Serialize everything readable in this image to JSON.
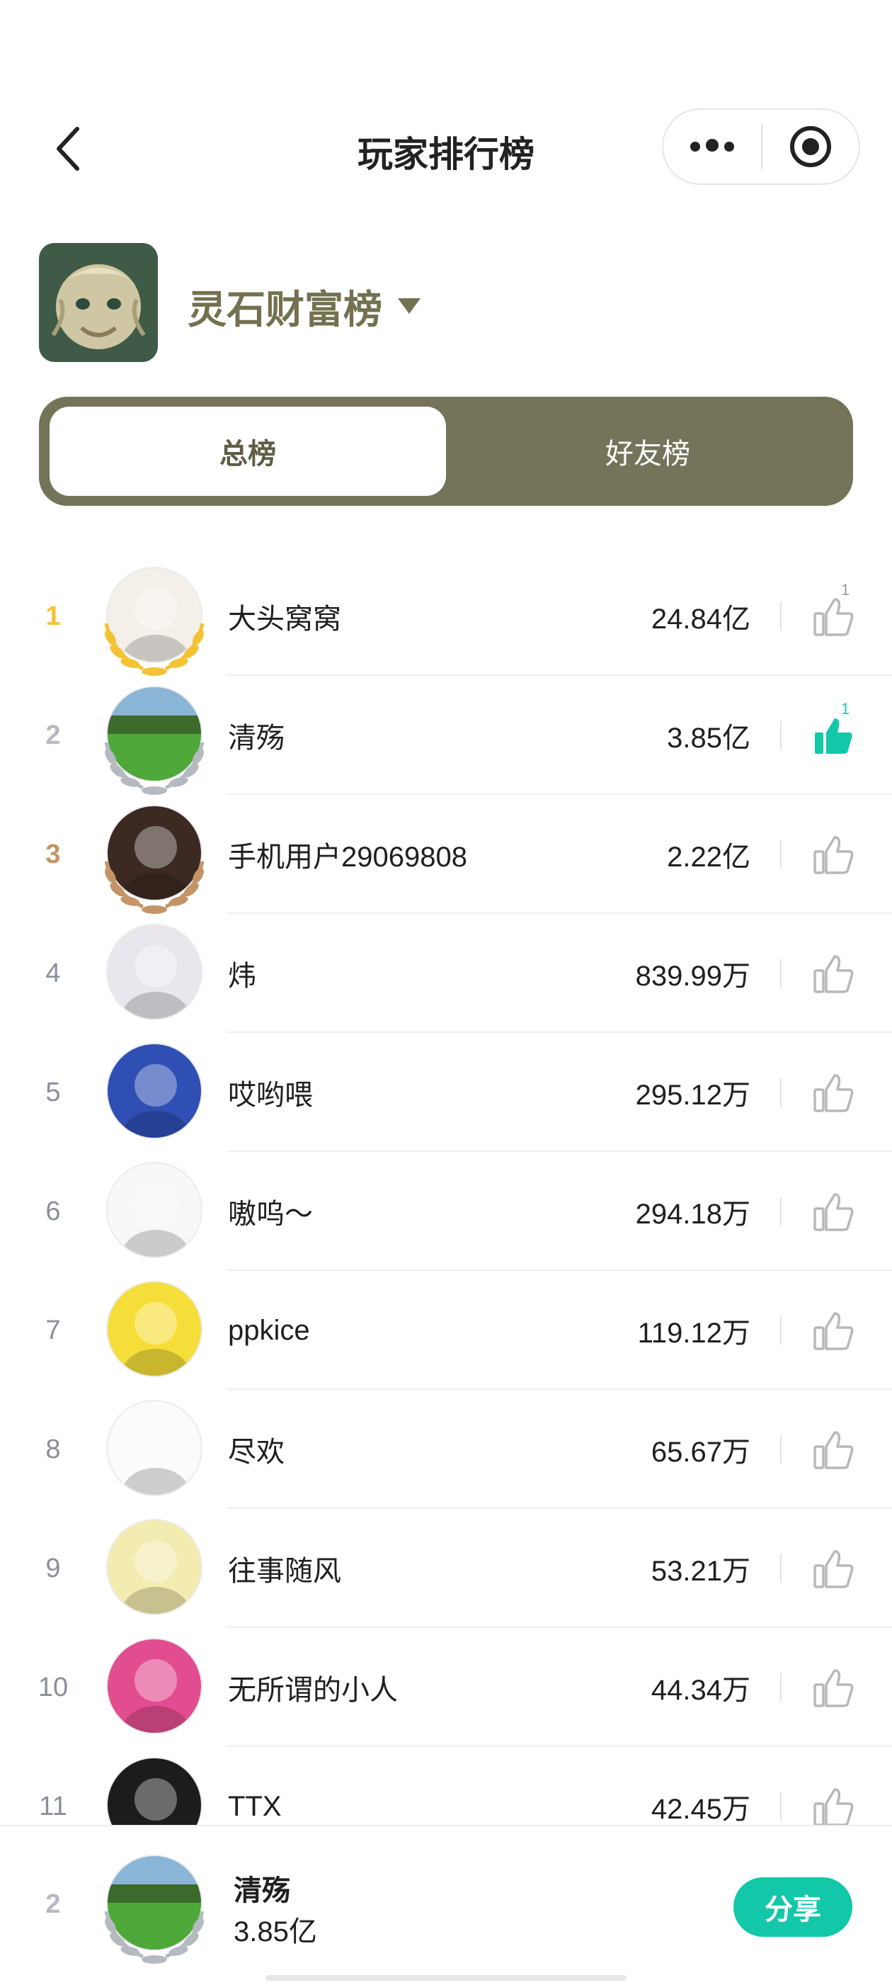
{
  "header": {
    "title": "玩家排行榜"
  },
  "board": {
    "name": "灵石财富榜"
  },
  "tabs": [
    {
      "label": "总榜",
      "active": true
    },
    {
      "label": "好友榜",
      "active": false
    }
  ],
  "ranking": [
    {
      "rank": "1",
      "name": "大头窝窝",
      "score": "24.84亿",
      "likes": "1",
      "liked": false,
      "avatar_color": "#f5efe9"
    },
    {
      "rank": "2",
      "name": "清殇",
      "score": "3.85亿",
      "likes": "1",
      "liked": true,
      "avatar_color": "#4f9a34"
    },
    {
      "rank": "3",
      "name": "手机用户29069808",
      "score": "2.22亿",
      "likes": "",
      "liked": false,
      "avatar_color": "#3c2a22"
    },
    {
      "rank": "4",
      "name": "炜",
      "score": "839.99万",
      "likes": "",
      "liked": false,
      "avatar_color": "#e9e6ee"
    },
    {
      "rank": "5",
      "name": "哎哟喂",
      "score": "295.12万",
      "likes": "",
      "liked": false,
      "avatar_color": "#2f4fb4"
    },
    {
      "rank": "6",
      "name": "嗷呜～",
      "score": "294.18万",
      "likes": "",
      "liked": false,
      "avatar_color": "#f8f8f8"
    },
    {
      "rank": "7",
      "name": "ppkice",
      "score": "119.12万",
      "likes": "",
      "liked": false,
      "avatar_color": "#f6de3a"
    },
    {
      "rank": "8",
      "name": "尽欢",
      "score": "65.67万",
      "likes": "",
      "liked": false,
      "avatar_color": "#fbfbfb"
    },
    {
      "rank": "9",
      "name": "往事随风",
      "score": "53.21万",
      "likes": "",
      "liked": false,
      "avatar_color": "#f3ecb0"
    },
    {
      "rank": "10",
      "name": "无所谓的小人",
      "score": "44.34万",
      "likes": "",
      "liked": false,
      "avatar_color": "#e24d8f"
    },
    {
      "rank": "11",
      "name": "TTX",
      "score": "42.45万",
      "likes": "",
      "liked": false,
      "avatar_color": "#1c1c1c"
    }
  ],
  "me": {
    "rank": "2",
    "name": "清殇",
    "score": "3.85亿"
  },
  "share_label": "分享",
  "colors": {
    "accent": "#13c8a9",
    "olive": "#75745b",
    "gold": "#f3c334",
    "silver": "#b5b9c0",
    "bronze": "#c49467"
  }
}
